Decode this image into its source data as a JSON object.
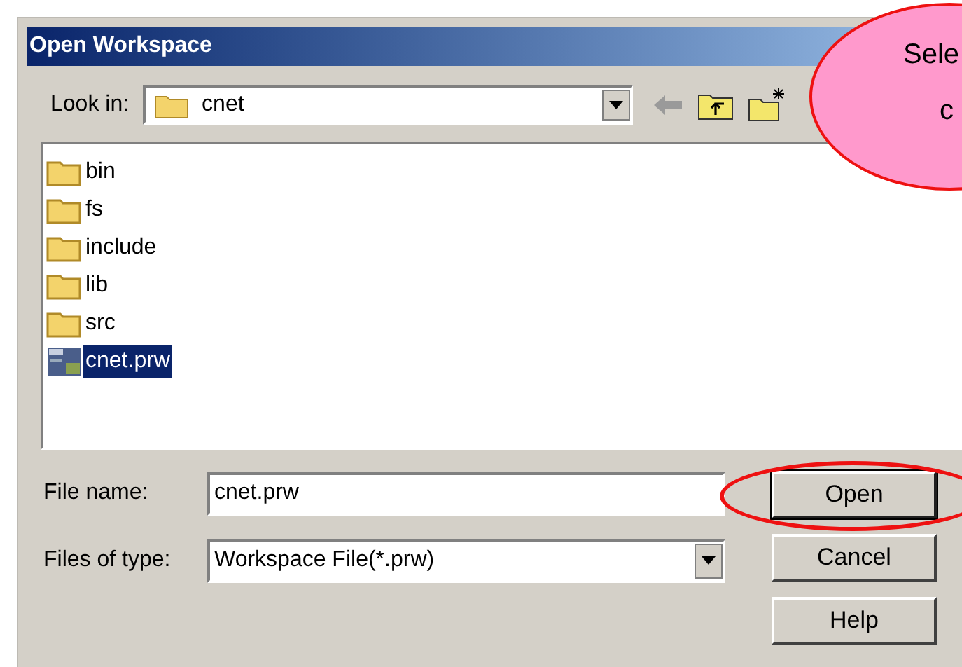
{
  "window": {
    "title": "Open Workspace"
  },
  "look_in": {
    "label": "Look in:",
    "value": "cnet"
  },
  "files": [
    {
      "name": "bin",
      "kind": "folder",
      "selected": false
    },
    {
      "name": "fs",
      "kind": "folder",
      "selected": false
    },
    {
      "name": "include",
      "kind": "folder",
      "selected": false
    },
    {
      "name": "lib",
      "kind": "folder",
      "selected": false
    },
    {
      "name": "src",
      "kind": "folder",
      "selected": false
    },
    {
      "name": "cnet.prw",
      "kind": "workspace",
      "selected": true
    }
  ],
  "file_name": {
    "label": "File name:",
    "value": "cnet.prw"
  },
  "file_type": {
    "label": "Files of type:",
    "value": "Workspace File(*.prw)"
  },
  "buttons": [
    {
      "label": "Open",
      "highlighted": true
    },
    {
      "label": "Cancel",
      "highlighted": false
    },
    {
      "label": "Help",
      "highlighted": false
    }
  ],
  "callout": {
    "lines": [
      "Sele",
      "c"
    ]
  }
}
